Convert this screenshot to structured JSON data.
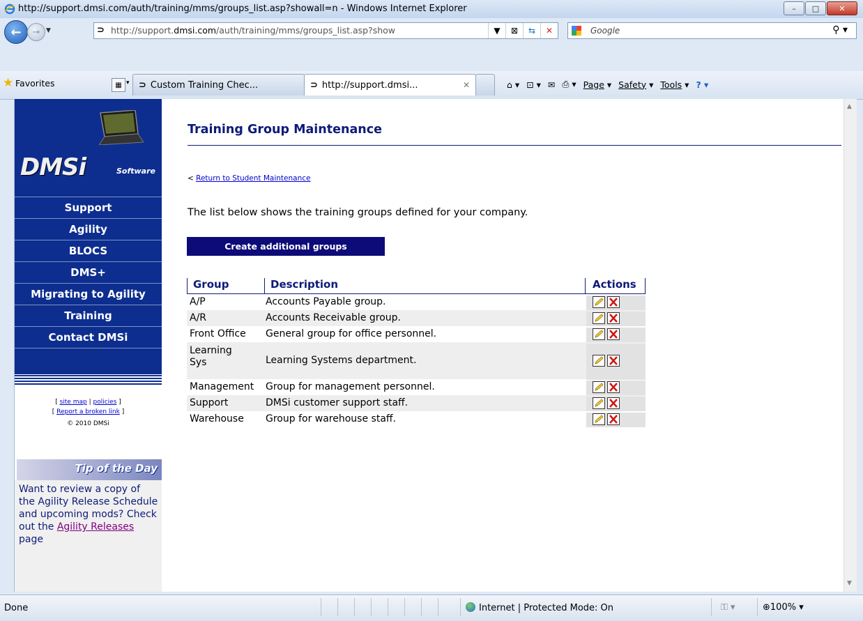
{
  "window": {
    "title": "http://support.dmsi.com/auth/training/mms/groups_list.asp?showall=n - Windows Internet Explorer",
    "minimize": "–",
    "maximize": "□",
    "close": "✕"
  },
  "address": {
    "url_prefix": "http://support.",
    "url_domain": "dmsi.com",
    "url_suffix": "/auth/training/mms/groups_list.asp?show",
    "search_placeholder": "Google"
  },
  "favorites": {
    "label": "Favorites"
  },
  "tabs": [
    {
      "label": "Custom Training Chec..."
    },
    {
      "label": "http://support.dmsi...",
      "close": "✕"
    }
  ],
  "commandbar": {
    "page": "Page",
    "safety": "Safety",
    "tools": "Tools"
  },
  "sidebar": {
    "logo_text": "DMSi",
    "logo_sub": "Software",
    "items": [
      {
        "label": "Support"
      },
      {
        "label": "Agility"
      },
      {
        "label": "BLOCS"
      },
      {
        "label": "DMS+"
      },
      {
        "label": "Migrating to Agility"
      },
      {
        "label": "Training"
      },
      {
        "label": "Contact DMSi"
      }
    ],
    "footer": {
      "site_map": "site map",
      "policies": "policies",
      "report": "Report a broken link",
      "copyright": "© 2010 DMSi"
    },
    "tip": {
      "header": "Tip of the Day",
      "text_before": "Want to review a copy of the Agility Release Schedule and upcoming mods? Check out the ",
      "link": "Agility Releases",
      "text_after": " page"
    }
  },
  "main": {
    "title": "Training Group Maintenance",
    "return_link": "Return to Student Maintenance",
    "intro": "The list below shows the training groups defined for your company.",
    "create_button": "Create additional groups",
    "table": {
      "headers": {
        "group": "Group",
        "description": "Description",
        "actions": "Actions"
      },
      "rows": [
        {
          "group": "A/P",
          "description": "Accounts Payable group."
        },
        {
          "group": "A/R",
          "description": "Accounts Receivable group."
        },
        {
          "group": "Front Office",
          "description": "General group for office personnel."
        },
        {
          "group": "Learning Sys",
          "description": "Learning Systems department."
        },
        {
          "group": "Management",
          "description": "Group for management personnel."
        },
        {
          "group": "Support",
          "description": "DMSi customer support staff."
        },
        {
          "group": "Warehouse",
          "description": "Group for warehouse staff."
        }
      ]
    }
  },
  "status": {
    "text": "Done",
    "zone": "Internet | Protected Mode: On",
    "zoom": "100%"
  },
  "colors": {
    "nav_blue": "#0d2e8f",
    "title_blue": "#0d1b78",
    "link_blue": "#0000cc"
  }
}
